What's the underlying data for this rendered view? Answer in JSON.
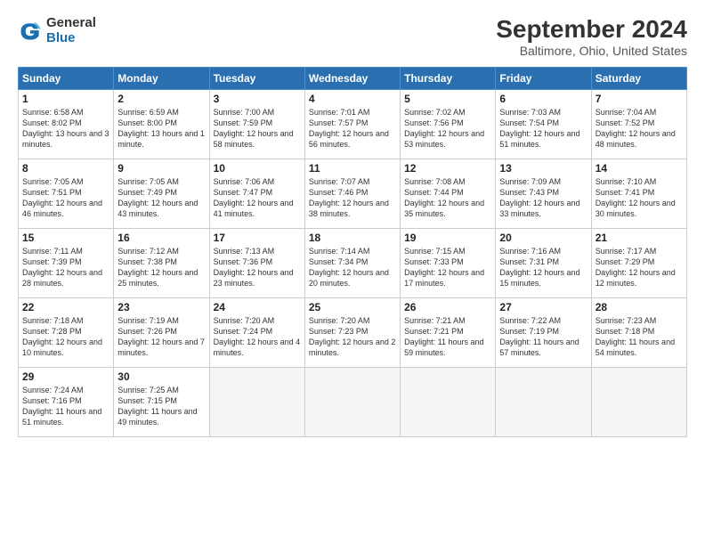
{
  "header": {
    "logo_line1": "General",
    "logo_line2": "Blue",
    "main_title": "September 2024",
    "subtitle": "Baltimore, Ohio, United States"
  },
  "calendar": {
    "headers": [
      "Sunday",
      "Monday",
      "Tuesday",
      "Wednesday",
      "Thursday",
      "Friday",
      "Saturday"
    ],
    "weeks": [
      [
        null,
        null,
        null,
        null,
        null,
        null,
        null
      ]
    ],
    "days": [
      {
        "num": "1",
        "col": 0,
        "sunrise": "Sunrise: 6:58 AM",
        "sunset": "Sunset: 8:02 PM",
        "daylight": "Daylight: 13 hours and 3 minutes."
      },
      {
        "num": "2",
        "col": 1,
        "sunrise": "Sunrise: 6:59 AM",
        "sunset": "Sunset: 8:00 PM",
        "daylight": "Daylight: 13 hours and 1 minute."
      },
      {
        "num": "3",
        "col": 2,
        "sunrise": "Sunrise: 7:00 AM",
        "sunset": "Sunset: 7:59 PM",
        "daylight": "Daylight: 12 hours and 58 minutes."
      },
      {
        "num": "4",
        "col": 3,
        "sunrise": "Sunrise: 7:01 AM",
        "sunset": "Sunset: 7:57 PM",
        "daylight": "Daylight: 12 hours and 56 minutes."
      },
      {
        "num": "5",
        "col": 4,
        "sunrise": "Sunrise: 7:02 AM",
        "sunset": "Sunset: 7:56 PM",
        "daylight": "Daylight: 12 hours and 53 minutes."
      },
      {
        "num": "6",
        "col": 5,
        "sunrise": "Sunrise: 7:03 AM",
        "sunset": "Sunset: 7:54 PM",
        "daylight": "Daylight: 12 hours and 51 minutes."
      },
      {
        "num": "7",
        "col": 6,
        "sunrise": "Sunrise: 7:04 AM",
        "sunset": "Sunset: 7:52 PM",
        "daylight": "Daylight: 12 hours and 48 minutes."
      },
      {
        "num": "8",
        "col": 0,
        "sunrise": "Sunrise: 7:05 AM",
        "sunset": "Sunset: 7:51 PM",
        "daylight": "Daylight: 12 hours and 46 minutes."
      },
      {
        "num": "9",
        "col": 1,
        "sunrise": "Sunrise: 7:05 AM",
        "sunset": "Sunset: 7:49 PM",
        "daylight": "Daylight: 12 hours and 43 minutes."
      },
      {
        "num": "10",
        "col": 2,
        "sunrise": "Sunrise: 7:06 AM",
        "sunset": "Sunset: 7:47 PM",
        "daylight": "Daylight: 12 hours and 41 minutes."
      },
      {
        "num": "11",
        "col": 3,
        "sunrise": "Sunrise: 7:07 AM",
        "sunset": "Sunset: 7:46 PM",
        "daylight": "Daylight: 12 hours and 38 minutes."
      },
      {
        "num": "12",
        "col": 4,
        "sunrise": "Sunrise: 7:08 AM",
        "sunset": "Sunset: 7:44 PM",
        "daylight": "Daylight: 12 hours and 35 minutes."
      },
      {
        "num": "13",
        "col": 5,
        "sunrise": "Sunrise: 7:09 AM",
        "sunset": "Sunset: 7:43 PM",
        "daylight": "Daylight: 12 hours and 33 minutes."
      },
      {
        "num": "14",
        "col": 6,
        "sunrise": "Sunrise: 7:10 AM",
        "sunset": "Sunset: 7:41 PM",
        "daylight": "Daylight: 12 hours and 30 minutes."
      },
      {
        "num": "15",
        "col": 0,
        "sunrise": "Sunrise: 7:11 AM",
        "sunset": "Sunset: 7:39 PM",
        "daylight": "Daylight: 12 hours and 28 minutes."
      },
      {
        "num": "16",
        "col": 1,
        "sunrise": "Sunrise: 7:12 AM",
        "sunset": "Sunset: 7:38 PM",
        "daylight": "Daylight: 12 hours and 25 minutes."
      },
      {
        "num": "17",
        "col": 2,
        "sunrise": "Sunrise: 7:13 AM",
        "sunset": "Sunset: 7:36 PM",
        "daylight": "Daylight: 12 hours and 23 minutes."
      },
      {
        "num": "18",
        "col": 3,
        "sunrise": "Sunrise: 7:14 AM",
        "sunset": "Sunset: 7:34 PM",
        "daylight": "Daylight: 12 hours and 20 minutes."
      },
      {
        "num": "19",
        "col": 4,
        "sunrise": "Sunrise: 7:15 AM",
        "sunset": "Sunset: 7:33 PM",
        "daylight": "Daylight: 12 hours and 17 minutes."
      },
      {
        "num": "20",
        "col": 5,
        "sunrise": "Sunrise: 7:16 AM",
        "sunset": "Sunset: 7:31 PM",
        "daylight": "Daylight: 12 hours and 15 minutes."
      },
      {
        "num": "21",
        "col": 6,
        "sunrise": "Sunrise: 7:17 AM",
        "sunset": "Sunset: 7:29 PM",
        "daylight": "Daylight: 12 hours and 12 minutes."
      },
      {
        "num": "22",
        "col": 0,
        "sunrise": "Sunrise: 7:18 AM",
        "sunset": "Sunset: 7:28 PM",
        "daylight": "Daylight: 12 hours and 10 minutes."
      },
      {
        "num": "23",
        "col": 1,
        "sunrise": "Sunrise: 7:19 AM",
        "sunset": "Sunset: 7:26 PM",
        "daylight": "Daylight: 12 hours and 7 minutes."
      },
      {
        "num": "24",
        "col": 2,
        "sunrise": "Sunrise: 7:20 AM",
        "sunset": "Sunset: 7:24 PM",
        "daylight": "Daylight: 12 hours and 4 minutes."
      },
      {
        "num": "25",
        "col": 3,
        "sunrise": "Sunrise: 7:20 AM",
        "sunset": "Sunset: 7:23 PM",
        "daylight": "Daylight: 12 hours and 2 minutes."
      },
      {
        "num": "26",
        "col": 4,
        "sunrise": "Sunrise: 7:21 AM",
        "sunset": "Sunset: 7:21 PM",
        "daylight": "Daylight: 11 hours and 59 minutes."
      },
      {
        "num": "27",
        "col": 5,
        "sunrise": "Sunrise: 7:22 AM",
        "sunset": "Sunset: 7:19 PM",
        "daylight": "Daylight: 11 hours and 57 minutes."
      },
      {
        "num": "28",
        "col": 6,
        "sunrise": "Sunrise: 7:23 AM",
        "sunset": "Sunset: 7:18 PM",
        "daylight": "Daylight: 11 hours and 54 minutes."
      },
      {
        "num": "29",
        "col": 0,
        "sunrise": "Sunrise: 7:24 AM",
        "sunset": "Sunset: 7:16 PM",
        "daylight": "Daylight: 11 hours and 51 minutes."
      },
      {
        "num": "30",
        "col": 1,
        "sunrise": "Sunrise: 7:25 AM",
        "sunset": "Sunset: 7:15 PM",
        "daylight": "Daylight: 11 hours and 49 minutes."
      }
    ]
  }
}
